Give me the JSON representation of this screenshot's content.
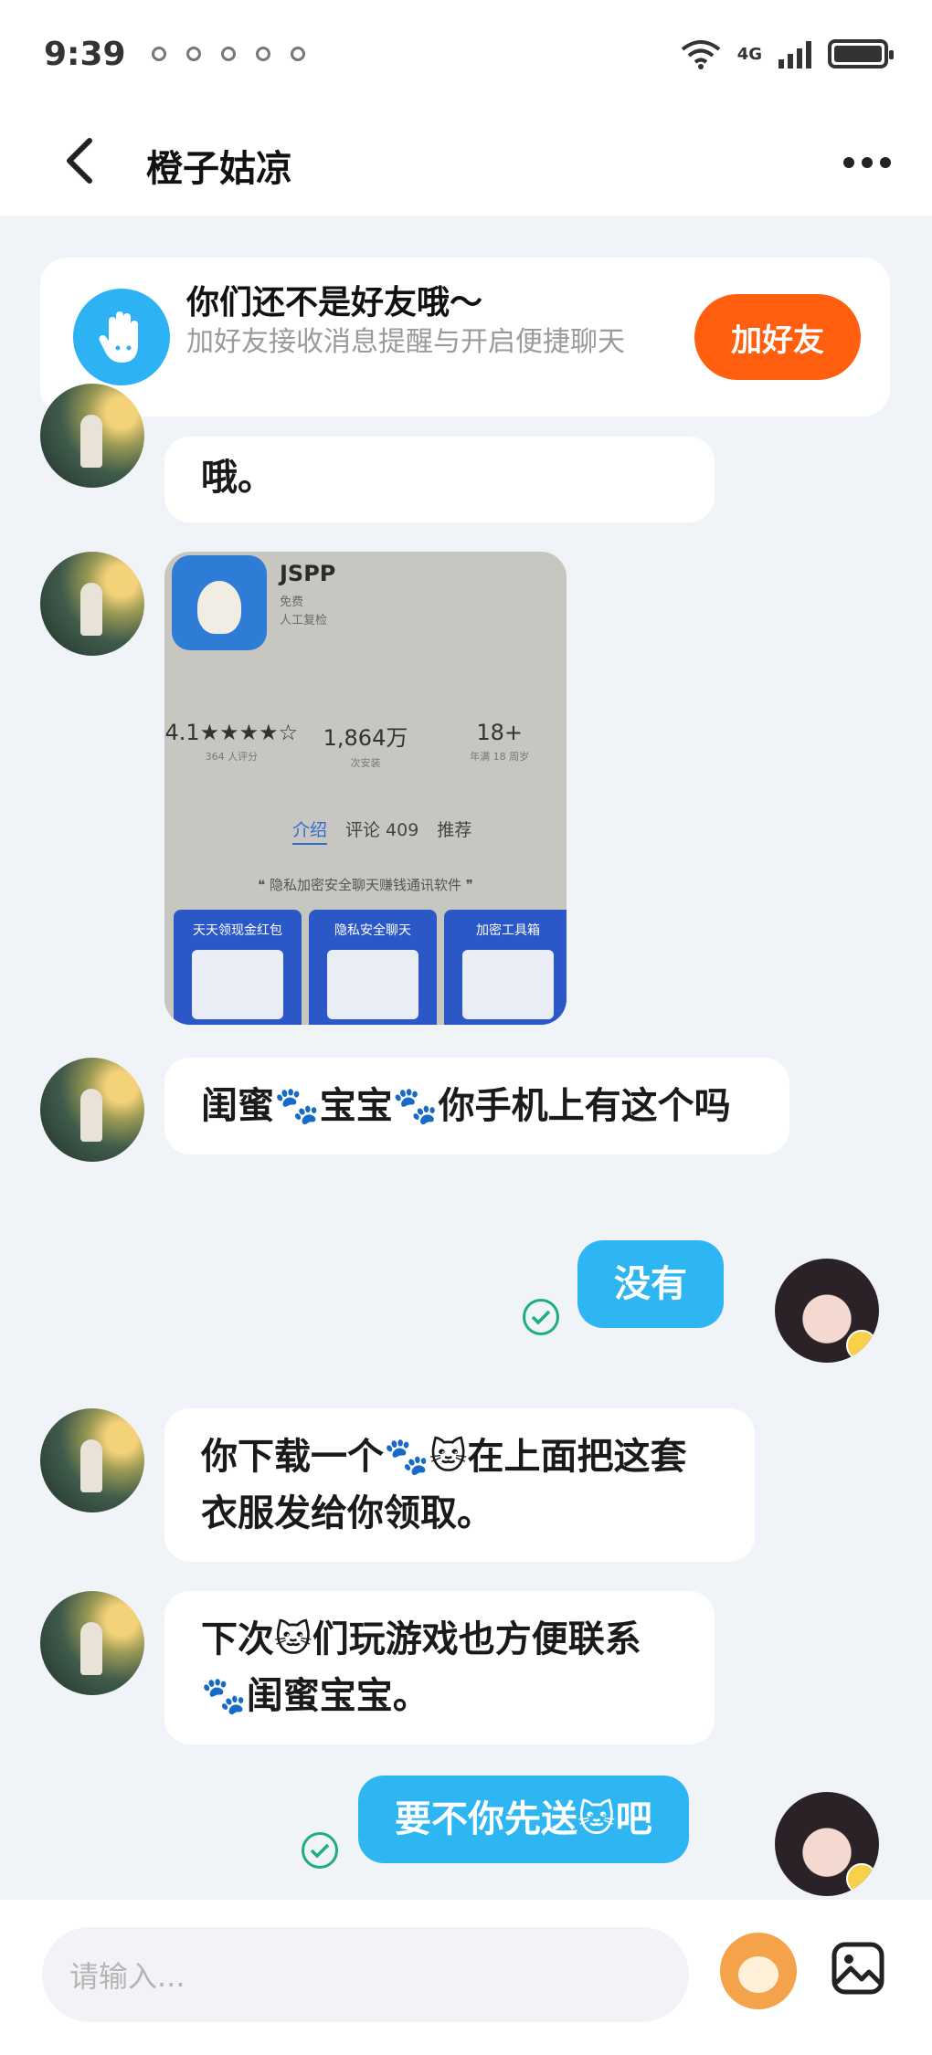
{
  "status_bar": {
    "time": "9:39",
    "network": "4G"
  },
  "header": {
    "title": "橙子姑凉"
  },
  "friend_banner": {
    "heading": "你们还不是好友哦～",
    "subtitle": "加好友接收消息提醒与开启便捷聊天",
    "button_label": "加好友"
  },
  "messages": [
    {
      "side": "left",
      "text": "哦。"
    },
    {
      "side": "left",
      "type": "image"
    },
    {
      "side": "left",
      "text": "闺蜜🐾宝宝🐾你手机上有这个吗"
    },
    {
      "side": "right",
      "text": "没有"
    },
    {
      "side": "left",
      "text": "你下载一个🐾🐱在上面把这套衣服发给你领取。"
    },
    {
      "side": "left",
      "text": "下次🐱们玩游戏也方便联系🐾闺蜜宝宝。"
    },
    {
      "side": "right",
      "text": "要不你先送🐱吧"
    }
  ],
  "app_screenshot": {
    "app_name": "JSPP",
    "price": "免费",
    "review_status": "人工复检",
    "rating": "4.1★★★★☆",
    "rating_count": "364 人评分",
    "installs": "1,864万",
    "installs_label": "次安装",
    "age": "18+",
    "age_label": "年满 18 周岁",
    "tabs": [
      "介绍",
      "评论 409",
      "推荐"
    ],
    "slogan": "❝ 隐私加密安全聊天赚钱通讯软件 ❞",
    "promos": [
      "天天领现金红包",
      "隐私安全聊天",
      "加密工具箱"
    ]
  },
  "input_bar": {
    "placeholder": "请输入..."
  },
  "colors": {
    "accent_blue": "#2eb6f2",
    "add_friend_orange": "#ff5f0e",
    "read_check_green": "#1fae7a"
  }
}
